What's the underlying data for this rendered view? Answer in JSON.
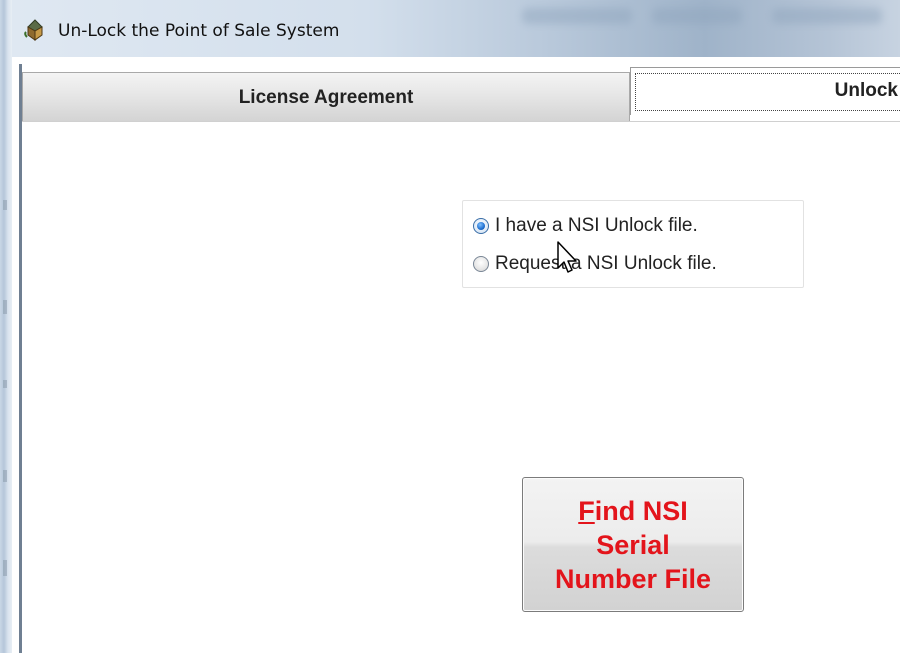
{
  "window": {
    "title": "Un-Lock the Point of Sale System",
    "icon": "app-icon"
  },
  "tabs": [
    {
      "label": "License Agreement",
      "selected": false
    },
    {
      "label": "Unlock",
      "selected": true
    }
  ],
  "unlock_options": {
    "options": [
      {
        "label": "I have a NSI Unlock file.",
        "checked": true
      },
      {
        "label": "Request a NSI Unlock file.",
        "checked": false
      }
    ]
  },
  "find_button": {
    "mnemonic": "F",
    "line1_rest": "ind NSI",
    "line2": "Serial",
    "line3": "Number File",
    "color": "#e3141b"
  },
  "colors": {
    "accent_radio": "#1f6fd0",
    "button_text": "#e3141b"
  }
}
